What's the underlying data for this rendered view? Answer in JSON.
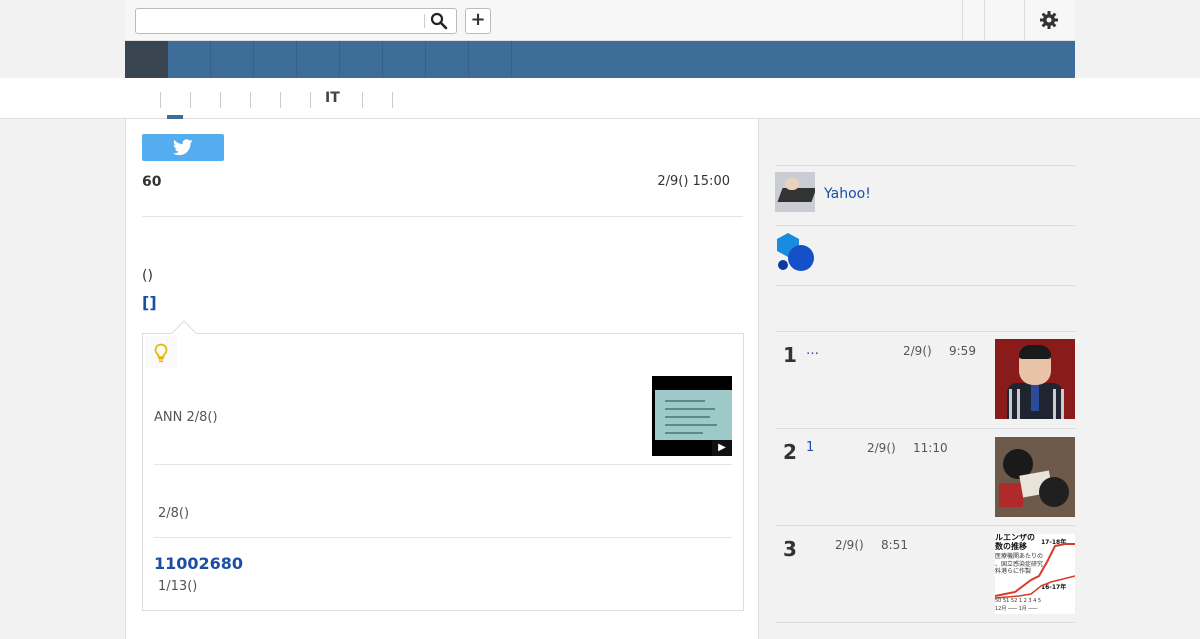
{
  "search": {
    "value": "",
    "placeholder": ""
  },
  "toolbar": {
    "plus_label": "+"
  },
  "subnav": {
    "it_label": "IT"
  },
  "article": {
    "count": "60",
    "date": "2/9() 15:00",
    "paren_text": "()",
    "brackets_link": "[]"
  },
  "related": {
    "ann_text": "ANN 2/8()",
    "date_b": "2/8()",
    "number_link": "11002680",
    "date_c": "1/13()",
    "play_icon": "▶"
  },
  "sidebar": {
    "yahoo_link": "Yahoo!",
    "ranking": [
      {
        "rank": "1",
        "title": "…",
        "date": "2/9()",
        "time": "9:59"
      },
      {
        "rank": "2",
        "title": "1",
        "date": "2/9()",
        "time": "11:10"
      },
      {
        "rank": "3",
        "title": "",
        "date": "2/9()",
        "time": "8:51"
      }
    ],
    "chart_thumb": {
      "line1": "ルエンザの",
      "line2": "数の推移",
      "line3": "医療機関あたりの",
      "line4": "、国立感染症研究",
      "line5": "料港らに作製",
      "label_a": "17-18年",
      "label_b": "16-17年",
      "axis1": "50 51 52 1  2  3  4  5",
      "axis2": "12月 ─── 1月 ───"
    }
  },
  "colors": {
    "nav": "#3f6d99",
    "nav_home": "#3a4552",
    "link": "#1a4fa3",
    "tweet": "#55acee"
  }
}
